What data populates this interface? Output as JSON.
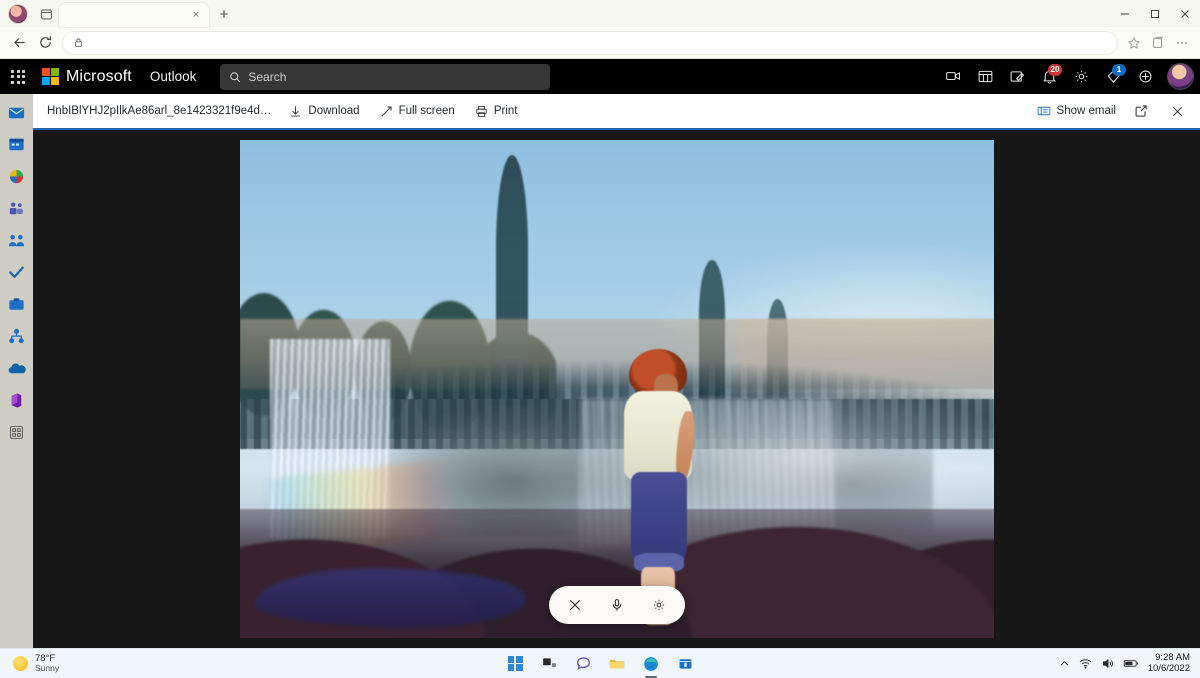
{
  "browser": {
    "tab": {
      "title": "",
      "close_label": "×"
    },
    "new_tab_label": "+",
    "window_controls": {
      "minimize": "–",
      "maximize": "❐",
      "close": "✕"
    },
    "nav": {
      "back": "←",
      "refresh": "↻"
    },
    "omnibox": {
      "value": "",
      "placeholder": "",
      "lock_icon": "lock-icon"
    },
    "addr_right": {
      "favorite": "favorites-star-icon",
      "collections": "collections-icon",
      "settings": "settings-more-icon"
    }
  },
  "outlook": {
    "waffle_label": "App launcher",
    "brand": "Microsoft",
    "app_name": "Outlook",
    "search": {
      "placeholder": "Search",
      "value": ""
    },
    "header_icons": [
      {
        "name": "meet-now-icon",
        "badge": ""
      },
      {
        "name": "teams-calendar-icon",
        "badge": ""
      },
      {
        "name": "notes-icon",
        "badge": ""
      },
      {
        "name": "notifications-bell-icon",
        "badge": "20",
        "badge_color": "#d13438"
      },
      {
        "name": "settings-gear-icon",
        "badge": ""
      },
      {
        "name": "help-icon",
        "badge": "1",
        "badge_color": "#0f6cbd"
      },
      {
        "name": "feedback-icon",
        "badge": ""
      }
    ],
    "avatar_label": "account-avatar"
  },
  "rail": {
    "items": [
      {
        "name": "mail-icon",
        "label": "Mail"
      },
      {
        "name": "calendar-icon",
        "label": "Calendar"
      },
      {
        "name": "people-icon",
        "label": "People"
      },
      {
        "name": "teams-icon",
        "label": "Teams"
      },
      {
        "name": "groups-icon",
        "label": "Groups"
      },
      {
        "name": "to-do-icon",
        "label": "To Do"
      },
      {
        "name": "files-icon",
        "label": "Files"
      },
      {
        "name": "visio-icon",
        "label": "Visio"
      },
      {
        "name": "onedrive-icon",
        "label": "OneDrive"
      },
      {
        "name": "office-icon",
        "label": "Office"
      },
      {
        "name": "more-apps-icon",
        "label": "More apps"
      }
    ]
  },
  "viewer": {
    "file_name": "HnbIBlYHJ2pIlkAe86arl_8e1423321f9e4d…",
    "download_label": "Download",
    "fullscreen_label": "Full screen",
    "print_label": "Print",
    "show_email_label": "Show email",
    "popout_label": "pop-out-icon",
    "close_label": "✕",
    "accent_color": "#2564a8"
  },
  "photo": {
    "alt": "Person in white shirt and blue rolled-up pants standing on dark rocks before a waterfall with rainbow, evergreen trees and blue sky",
    "controls": {
      "close": "✕",
      "mic": "microphone-icon",
      "settings": "settings-gear-icon"
    }
  },
  "taskbar": {
    "weather": {
      "temp": "78°F",
      "condition": "Sunny"
    },
    "apps": [
      {
        "name": "start-button",
        "label": "Start"
      },
      {
        "name": "task-view-icon",
        "label": "Task view"
      },
      {
        "name": "chat-icon",
        "label": "Chat"
      },
      {
        "name": "file-explorer-icon",
        "label": "File Explorer"
      },
      {
        "name": "edge-icon",
        "label": "Microsoft Edge"
      },
      {
        "name": "store-icon",
        "label": "Microsoft Store"
      }
    ],
    "tray": {
      "chevron": "∧",
      "wifi": "wifi-icon",
      "volume": "volume-icon",
      "battery": "battery-icon"
    },
    "clock": {
      "time": "9:28 AM",
      "date": "10/6/2022"
    }
  }
}
